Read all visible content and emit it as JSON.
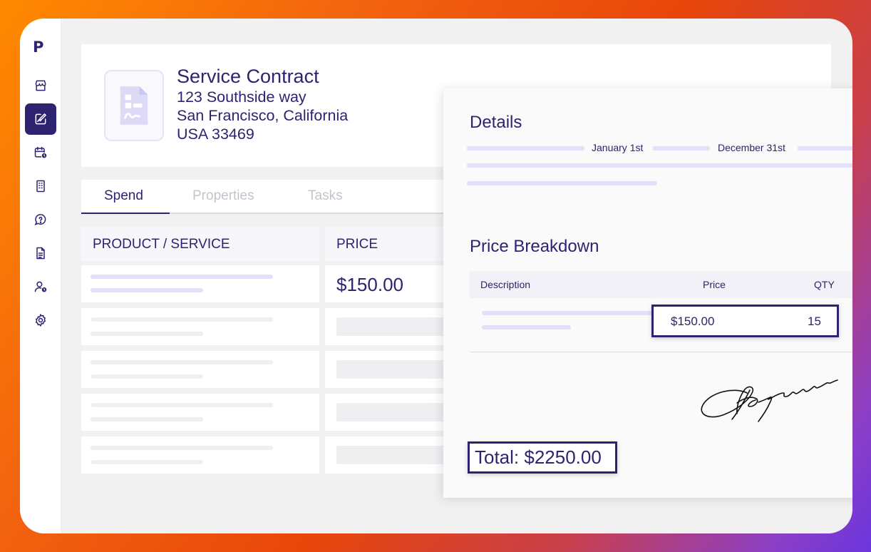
{
  "app": {
    "logo": "P"
  },
  "sidebar": {
    "items": [
      {
        "icon": "store-icon",
        "active": false
      },
      {
        "icon": "contract-edit-icon",
        "active": true
      },
      {
        "icon": "calendar-clock-icon",
        "active": false
      },
      {
        "icon": "building-icon",
        "active": false
      },
      {
        "icon": "help-chat-icon",
        "active": false
      },
      {
        "icon": "document-icon",
        "active": false
      },
      {
        "icon": "user-clock-icon",
        "active": false
      },
      {
        "icon": "settings-icon",
        "active": false
      }
    ]
  },
  "header": {
    "title": "Service Contract",
    "address_line1": "123 Southside way",
    "address_line2": "San Francisco, California",
    "address_line3": "USA 33469"
  },
  "tabs": [
    {
      "label": "Spend",
      "active": true
    },
    {
      "label": "Properties",
      "active": false
    },
    {
      "label": "Tasks",
      "active": false
    }
  ],
  "table": {
    "columns": [
      "PRODUCT / SERVICE",
      "PRICE"
    ],
    "rows": [
      {
        "price": "$150.00"
      }
    ]
  },
  "details": {
    "title": "Details",
    "start_date": "January 1st",
    "end_date": "December 31st",
    "price_breakdown": {
      "title": "Price Breakdown",
      "headers": {
        "description": "Description",
        "price": "Price",
        "qty": "QTY"
      },
      "row": {
        "price": "$150.00",
        "qty": "15"
      }
    },
    "total": "Total: $2250.00"
  },
  "colors": {
    "primary": "#2d2370",
    "placeholder_purple": "#e2e0fa",
    "placeholder_gray": "#efeff2",
    "gradient_start": "#ff8a00",
    "gradient_end": "#6b35dd"
  }
}
